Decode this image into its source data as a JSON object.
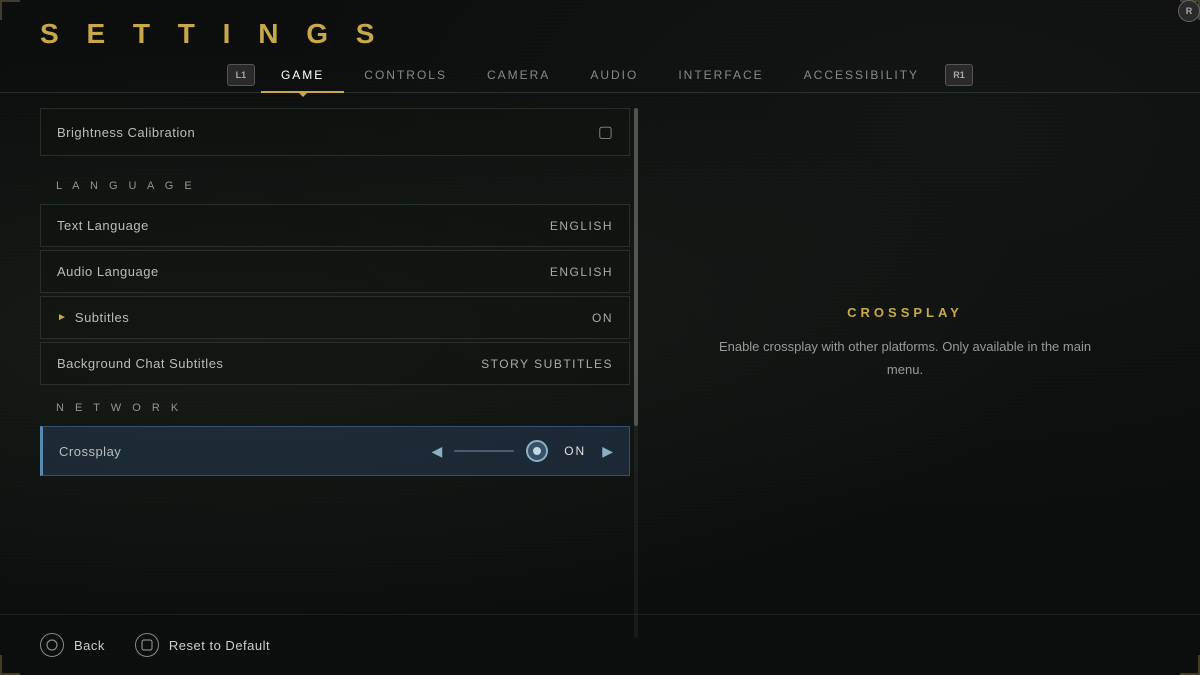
{
  "page": {
    "title": "S E T T I N G S"
  },
  "nav": {
    "bumper_left": "L1",
    "bumper_right": "R1",
    "tabs": [
      {
        "id": "game",
        "label": "GAME",
        "active": true
      },
      {
        "id": "controls",
        "label": "CONTROLS",
        "active": false
      },
      {
        "id": "camera",
        "label": "CAMERA",
        "active": false
      },
      {
        "id": "audio",
        "label": "AUDIO",
        "active": false
      },
      {
        "id": "interface",
        "label": "INTERFACE",
        "active": false
      },
      {
        "id": "accessibility",
        "label": "ACCESSIBILITY",
        "active": false
      }
    ]
  },
  "settings": {
    "brightness": {
      "label": "Brightness Calibration"
    },
    "language_section": "L A N G U A G E",
    "text_language": {
      "label": "Text Language",
      "value": "ENGLISH"
    },
    "audio_language": {
      "label": "Audio Language",
      "value": "ENGLISH"
    },
    "subtitles": {
      "label": "Subtitles",
      "value": "ON"
    },
    "background_chat": {
      "label": "Background Chat Subtitles",
      "value": "STORY SUBTITLES"
    },
    "network_section": "N E T W O R K",
    "crossplay": {
      "label": "Crossplay",
      "value": "ON"
    }
  },
  "right_panel": {
    "title": "CROSSPLAY",
    "description": "Enable crossplay with other platforms. Only available in the main menu."
  },
  "footer": {
    "back_label": "Back",
    "reset_label": "Reset to Default"
  }
}
